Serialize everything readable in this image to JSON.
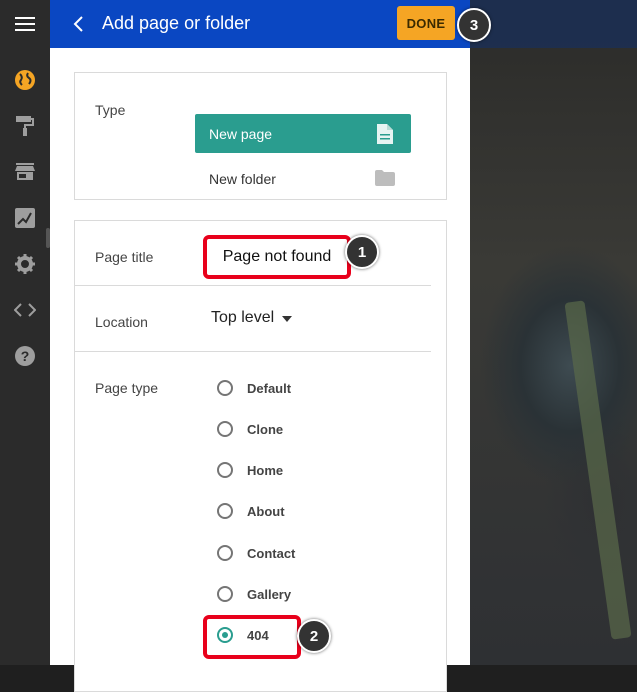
{
  "header": {
    "title": "Add page or folder",
    "done_label": "DONE",
    "accent_color": "#0a47c2",
    "done_color": "#f5a524"
  },
  "badges": {
    "one": "1",
    "two": "2",
    "three": "3"
  },
  "rail": {
    "icons": [
      "menu-icon",
      "globe-icon",
      "paint-roller-icon",
      "store-icon",
      "edit-image-icon",
      "gear-icon",
      "code-icon",
      "help-icon"
    ]
  },
  "type_section": {
    "label": "Type",
    "options": [
      {
        "label": "New page",
        "selected": true
      },
      {
        "label": "New folder",
        "selected": false
      }
    ]
  },
  "form": {
    "page_title_label": "Page title",
    "page_title_value": "Page not found",
    "location_label": "Location",
    "location_value": "Top level",
    "page_type_label": "Page type",
    "page_types": [
      {
        "label": "Default",
        "selected": false
      },
      {
        "label": "Clone",
        "selected": false
      },
      {
        "label": "Home",
        "selected": false
      },
      {
        "label": "About",
        "selected": false
      },
      {
        "label": "Contact",
        "selected": false
      },
      {
        "label": "Gallery",
        "selected": false
      },
      {
        "label": "404",
        "selected": true
      }
    ]
  }
}
